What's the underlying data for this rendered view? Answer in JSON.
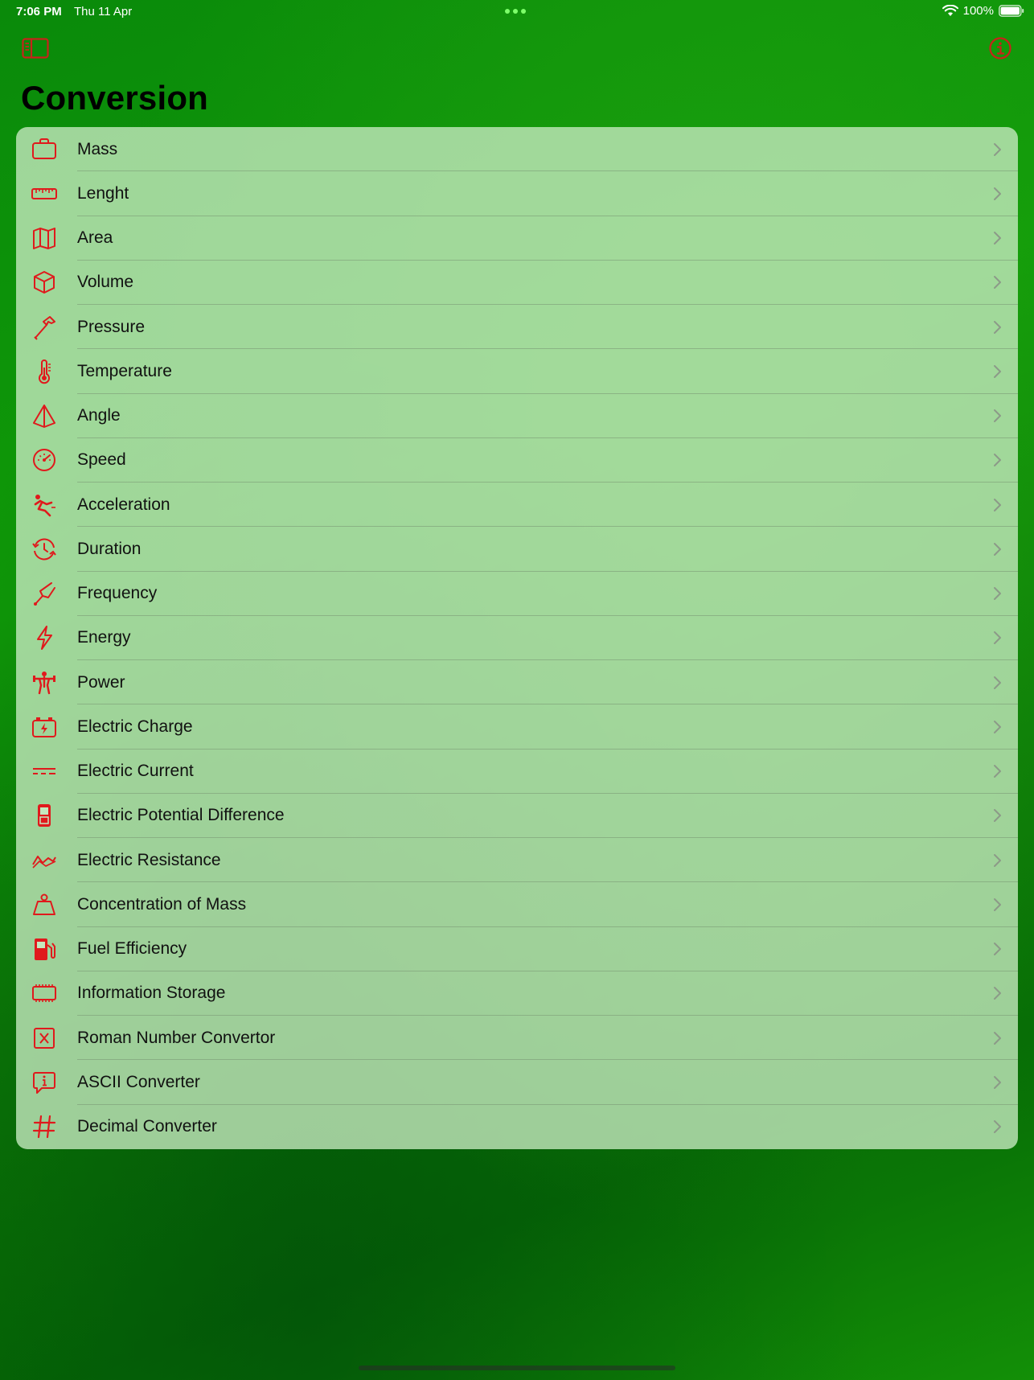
{
  "status_bar": {
    "time": "7:06 PM",
    "date": "Thu 11 Apr",
    "battery": "100%"
  },
  "header": {
    "title": "Conversion"
  },
  "colors": {
    "accent": "#e0191c",
    "card": "#c4e8be"
  },
  "items": [
    {
      "label": "Mass",
      "icon": "briefcase-icon"
    },
    {
      "label": "Lenght",
      "icon": "ruler-icon"
    },
    {
      "label": "Area",
      "icon": "map-icon"
    },
    {
      "label": "Volume",
      "icon": "cube-icon"
    },
    {
      "label": "Pressure",
      "icon": "hammer-icon"
    },
    {
      "label": "Temperature",
      "icon": "thermometer-icon"
    },
    {
      "label": "Angle",
      "icon": "pyramid-icon"
    },
    {
      "label": "Speed",
      "icon": "speedometer-icon"
    },
    {
      "label": "Acceleration",
      "icon": "figure-fall-icon"
    },
    {
      "label": "Duration",
      "icon": "clock-arrows-icon"
    },
    {
      "label": "Frequency",
      "icon": "tuning-fork-icon"
    },
    {
      "label": "Energy",
      "icon": "bolt-icon"
    },
    {
      "label": "Power",
      "icon": "weightlifter-icon"
    },
    {
      "label": "Electric Charge",
      "icon": "battery-bolt-icon"
    },
    {
      "label": "Electric Current",
      "icon": "dc-current-icon"
    },
    {
      "label": "Electric Potential Difference",
      "icon": "switch-icon"
    },
    {
      "label": "Electric Resistance",
      "icon": "waveform-icon"
    },
    {
      "label": "Concentration of Mass",
      "icon": "scale-weight-icon"
    },
    {
      "label": "Fuel Efficiency",
      "icon": "fuel-pump-icon"
    },
    {
      "label": "Information Storage",
      "icon": "memory-chip-icon"
    },
    {
      "label": "Roman Number Convertor",
      "icon": "x-square-icon"
    },
    {
      "label": "ASCII Converter",
      "icon": "info-bubble-icon"
    },
    {
      "label": "Decimal Converter",
      "icon": "number-sign-icon"
    }
  ]
}
